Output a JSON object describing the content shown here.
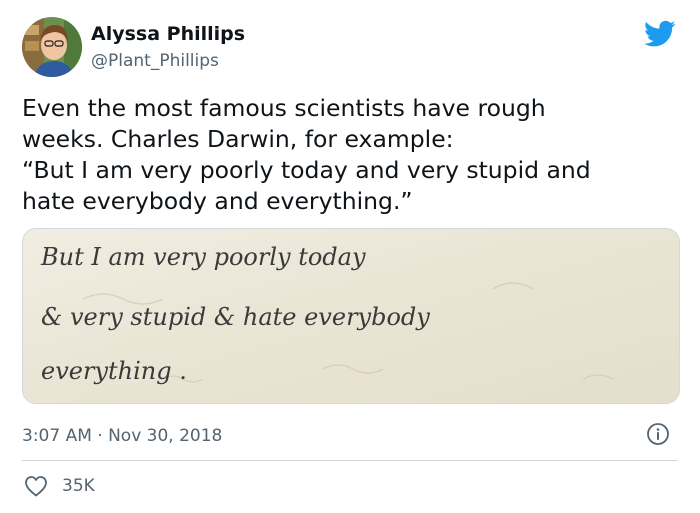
{
  "author": {
    "display_name": "Alyssa Phillips",
    "handle": "@Plant_Phillips"
  },
  "tweet": {
    "lines": [
      "Even the most famous scientists have rough",
      "weeks. Charles Darwin, for example:",
      "“But I am very poorly today and very stupid and",
      "hate everybody and everything.”"
    ],
    "timestamp": "3:07 AM · Nov 30, 2018",
    "likes": "35K"
  },
  "media": {
    "handwriting_lines": [
      "But  I  am  very  poorly  today",
      "& very  stupid  &  hate  everybody",
      "everything ."
    ]
  },
  "icons": {
    "twitter": "twitter-bird-icon",
    "info": "info-icon",
    "like": "heart-icon"
  },
  "colors": {
    "brand": "#1d9bf0",
    "text": "#0f1419",
    "secondary": "#536471",
    "border": "#cfd9de",
    "paper": "#ece7d8"
  }
}
